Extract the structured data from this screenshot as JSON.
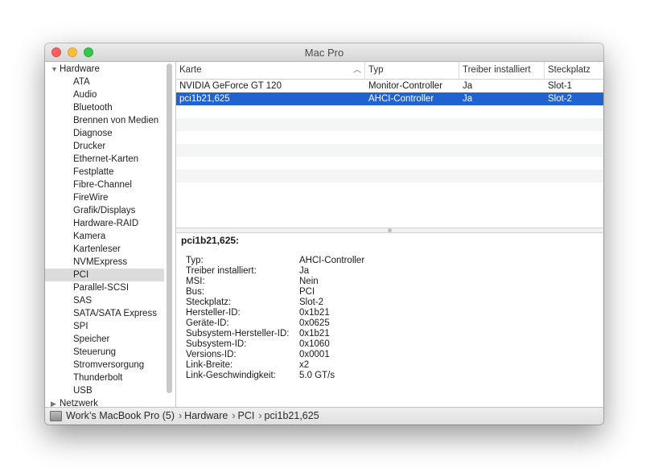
{
  "window": {
    "title": "Mac Pro"
  },
  "sidebar": {
    "group_hardware": "Hardware",
    "group_network": "Netzwerk",
    "items": [
      "ATA",
      "Audio",
      "Bluetooth",
      "Brennen von Medien",
      "Diagnose",
      "Drucker",
      "Ethernet-Karten",
      "Festplatte",
      "Fibre-Channel",
      "FireWire",
      "Grafik/Displays",
      "Hardware-RAID",
      "Kamera",
      "Kartenleser",
      "NVMExpress",
      "PCI",
      "Parallel-SCSI",
      "SAS",
      "SATA/SATA Express",
      "SPI",
      "Speicher",
      "Steuerung",
      "Stromversorgung",
      "Thunderbolt",
      "USB"
    ],
    "selected_index": 15
  },
  "table": {
    "columns": [
      "Karte",
      "Typ",
      "Treiber installiert",
      "Steckplatz"
    ],
    "sort_column": 0,
    "rows": [
      [
        "NVIDIA GeForce GT 120",
        "Monitor-Controller",
        "Ja",
        "Slot-1"
      ],
      [
        "pci1b21,625",
        "AHCI-Controller",
        "Ja",
        "Slot-2"
      ]
    ],
    "selected_row": 1
  },
  "detail": {
    "title": "pci1b21,625:",
    "properties": [
      {
        "key": "Typ:",
        "value": "AHCI-Controller"
      },
      {
        "key": "Treiber installiert:",
        "value": "Ja"
      },
      {
        "key": "MSI:",
        "value": "Nein"
      },
      {
        "key": "Bus:",
        "value": "PCI"
      },
      {
        "key": "Steckplatz:",
        "value": "Slot-2"
      },
      {
        "key": "Hersteller-ID:",
        "value": "0x1b21"
      },
      {
        "key": "Geräte-ID:",
        "value": "0x0625"
      },
      {
        "key": "Subsystem-Hersteller-ID:",
        "value": "0x1b21"
      },
      {
        "key": "Subsystem-ID:",
        "value": "0x1060"
      },
      {
        "key": "Versions-ID:",
        "value": "0x0001"
      },
      {
        "key": "Link-Breite:",
        "value": "x2"
      },
      {
        "key": "Link-Geschwindigkeit:",
        "value": "5.0 GT/s"
      }
    ]
  },
  "statusbar": {
    "breadcrumbs": [
      "Work’s MacBook Pro (5)",
      "Hardware",
      "PCI",
      "pci1b21,625"
    ],
    "separator": "›"
  },
  "icons": {
    "close": "close-button",
    "minimize": "minimize-button",
    "zoom": "zoom-button",
    "sort": "sort-ascending-icon",
    "computer": "computer-icon"
  },
  "colors": {
    "selection": "#1f62d0",
    "sidebar_selection": "#dcdcdc",
    "close": "#fc605c",
    "minimize": "#fdbc40",
    "zoom": "#34c84a"
  }
}
